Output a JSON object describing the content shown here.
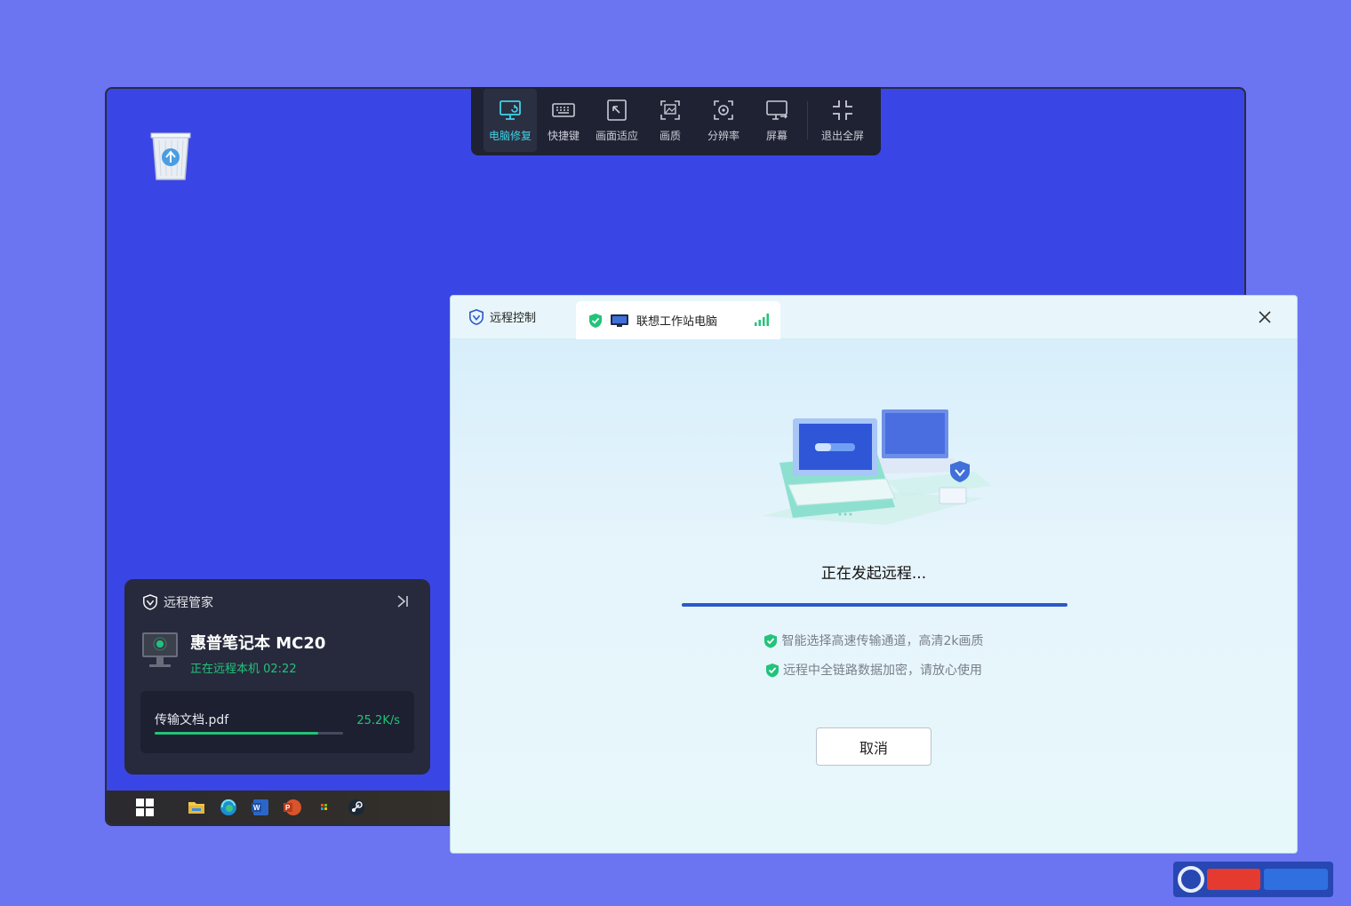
{
  "toolbar": {
    "items": [
      {
        "label": "电脑修复",
        "icon": "monitor-repair-icon",
        "active": true
      },
      {
        "label": "快捷键",
        "icon": "keyboard-icon"
      },
      {
        "label": "画面适应",
        "icon": "fit-screen-icon"
      },
      {
        "label": "画质",
        "icon": "image-quality-icon"
      },
      {
        "label": "分辨率",
        "icon": "resolution-icon"
      },
      {
        "label": "屏幕",
        "icon": "screen-switch-icon"
      },
      {
        "label": "退出全屏",
        "icon": "exit-fullscreen-icon"
      }
    ]
  },
  "manager": {
    "title": "远程管家",
    "device_name": "惠普笔记本 MC20",
    "status": "正在远程本机 02:22",
    "file": {
      "name": "传输文档.pdf",
      "speed": "25.2K/s",
      "progress": 0.87
    }
  },
  "dialog": {
    "tab1_label": "远程控制",
    "tab2_label": "联想工作站电脑",
    "status_title": "正在发起远程...",
    "progress": 1.0,
    "tip1": "智能选择高速传输通道，高清2k画质",
    "tip2": "远程中全链路数据加密，请放心使用",
    "cancel_label": "取消"
  },
  "colors": {
    "page_bg": "#6b74f1",
    "desktop_bg": "#3a45e6",
    "toolbar_bg": "#1f2232",
    "accent_cyan": "#3fd3e6",
    "accent_green": "#22c37a",
    "progress_blue": "#2c59c8"
  }
}
